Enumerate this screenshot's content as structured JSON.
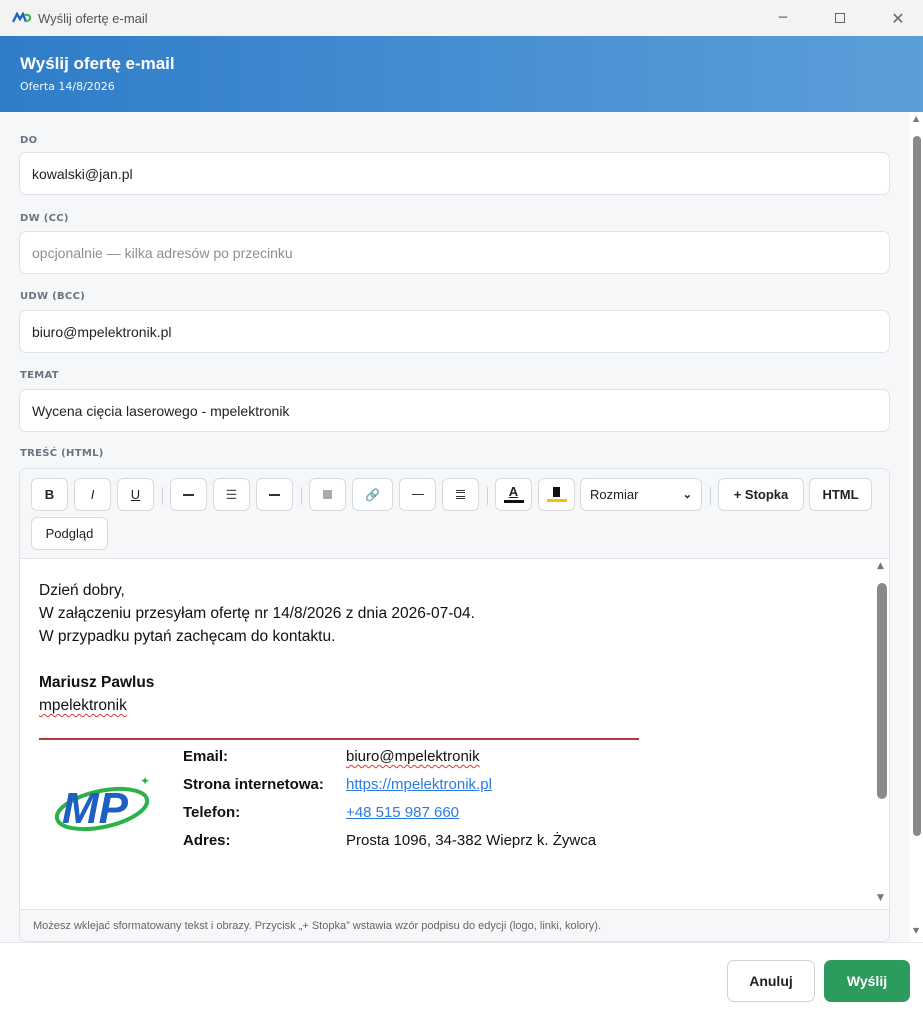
{
  "window": {
    "title": "Wyślij ofertę e-mail"
  },
  "header": {
    "title": "Wyślij ofertę e-mail",
    "subtitle": "Oferta 14/8/2026"
  },
  "fields": {
    "to": {
      "label": "DO",
      "value": "kowalski@jan.pl"
    },
    "cc": {
      "label": "DW (CC)",
      "placeholder": "opcjonalnie — kilka adresów po przecinku"
    },
    "bcc": {
      "label": "UDW (BCC)",
      "value": "biuro@mpelektronik.pl"
    },
    "subject": {
      "label": "TEMAT",
      "value": "Wycena cięcia laserowego - mpelektronik"
    },
    "body_label": "TREŚĆ (HTML)"
  },
  "toolbar": {
    "bold": "B",
    "italic": "I",
    "underline": "U",
    "size_select": "Rozmiar",
    "footer_button": "+ Stopka",
    "html_button": "HTML",
    "preview_button": "Podgląd",
    "font_color": "#111111",
    "highlight_color": "#f2c200"
  },
  "message": {
    "lines": [
      "Dzień dobry,",
      "W załączeniu przesyłam ofertę nr 14/8/2026 z dnia 2026-07-04.",
      "W przypadku pytań zachęcam do kontaktu."
    ],
    "signature_name": "Mariusz Pawlus",
    "signature_company": "mpelektronik",
    "signature_rows": [
      {
        "label": "Email:",
        "value": "biuro@mpelektronik"
      },
      {
        "label": "Strona internetowa:",
        "value": "https://mpelektronik.pl"
      },
      {
        "label": "Telefon:",
        "value": "+48 515 987 660"
      },
      {
        "label": "Adres:",
        "value": "Prosta 1096, 34-382 Wieprz k. Żywca"
      }
    ],
    "logo_text": "MP",
    "divider_color": "#b33b3b",
    "link_color": "#2a7be4"
  },
  "hint": "Możesz wklejać sformatowany tekst i obrazy. Przycisk „+ Stopka” wstawia wzór podpisu do edycji (logo, linki, kolory).",
  "footer": {
    "cancel": "Anuluj",
    "send": "Wyślij",
    "send_color": "#2e9b5e"
  },
  "colors": {
    "header_start": "#2f7dc9",
    "header_end": "#5b9fd9"
  }
}
